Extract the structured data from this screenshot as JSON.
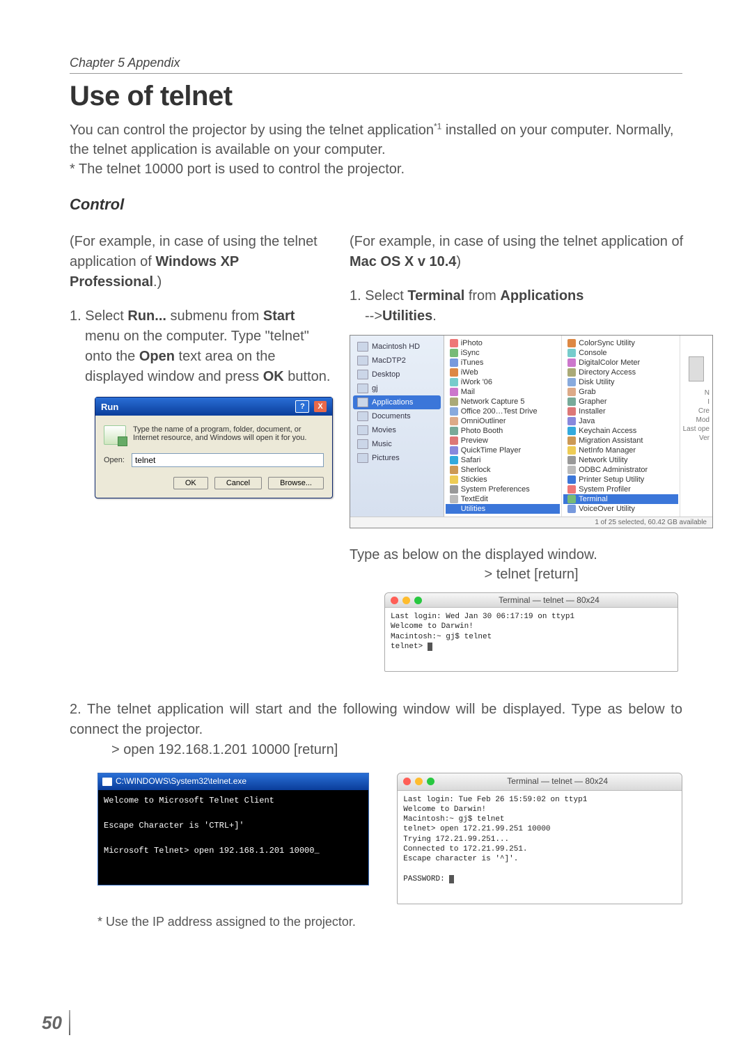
{
  "header": {
    "chapter": "Chapter 5 Appendix"
  },
  "title": "Use of telnet",
  "intro1": "You can control the projector by using the telnet application",
  "intro1_sup": "*1",
  "intro1_tail": " installed on your computer. Normally, the telnet application is available on your computer.",
  "intro2": "* The telnet 10000 port is used to control the projector.",
  "control_hdr": "Control",
  "left": {
    "para": "(For example, in case of using the telnet application of ",
    "para_bold": "Windows XP Professional",
    "para_tail": ".)",
    "step1_a": "1. Select ",
    "step1_b": "Run...",
    "step1_c": " submenu from ",
    "step1_d": "Start",
    "step1_e": " menu on the computer. Type \"telnet\" onto the ",
    "step1_f": "Open",
    "step1_g": " text area on the displayed window and press ",
    "step1_h": "OK",
    "step1_i": " button."
  },
  "run": {
    "title": "Run",
    "desc": "Type the name of a program, folder, document, or Internet resource, and Windows will open it for you.",
    "open_label": "Open:",
    "value": "telnet",
    "ok": "OK",
    "cancel": "Cancel",
    "browse": "Browse..."
  },
  "right": {
    "para": "(For example, in case of using the telnet application of ",
    "para_bold": "Mac OS X v 10.4",
    "para_tail": ")",
    "step1_a": "1. Select ",
    "step1_b": "Terminal",
    "step1_c": " from ",
    "step1_d": "Applications",
    "step1_e": " -->",
    "step1_f": "Utilities",
    "step1_g": "."
  },
  "finder": {
    "sidebar": [
      "Macintosh HD",
      "MacDTP2",
      "Desktop",
      "gj",
      "Applications",
      "Documents",
      "Movies",
      "Music",
      "Pictures"
    ],
    "sidebar_selected": "Applications",
    "apps": [
      "iPhoto",
      "iSync",
      "iTunes",
      "iWeb",
      "iWork '06",
      "Mail",
      "Network Capture 5",
      "Office 200…Test Drive",
      "OmniOutliner",
      "Photo Booth",
      "Preview",
      "QuickTime Player",
      "Safari",
      "Sherlock",
      "Stickies",
      "System Preferences",
      "TextEdit",
      "Utilities"
    ],
    "apps_selected": "Utilities",
    "utils": [
      "ColorSync Utility",
      "Console",
      "DigitalColor Meter",
      "Directory Access",
      "Disk Utility",
      "Grab",
      "Grapher",
      "Installer",
      "Java",
      "Keychain Access",
      "Migration Assistant",
      "NetInfo Manager",
      "Network Utility",
      "ODBC Administrator",
      "Printer Setup Utility",
      "System Profiler",
      "Terminal",
      "VoiceOver Utility"
    ],
    "utils_selected": "Terminal",
    "preview_lines": [
      "N",
      "I",
      "Cre",
      "Mod",
      "Last ope",
      "Ver"
    ],
    "status": "1 of 25 selected, 60.42 GB available"
  },
  "typeline1": "Type  as below on the displayed window.",
  "typeline1_cmd": "> telnet [return]",
  "macterm1": {
    "title": "Terminal — telnet — 80x24",
    "body": "Last login: Wed Jan 30 06:17:19 on ttyp1\nWelcome to Darwin!\nMacintosh:~ gj$ telnet\ntelnet> "
  },
  "step2": "2. The telnet application will start and the following window will be displayed. Type as below to connect the projector.",
  "step2_cmd": "> open 192.168.1.201 10000 [return]",
  "winterm": {
    "title": "C:\\WINDOWS\\System32\\telnet.exe",
    "body": "Welcome to Microsoft Telnet Client\n\nEscape Character is 'CTRL+]'\n\nMicrosoft Telnet> open 192.168.1.201 10000_"
  },
  "macterm2": {
    "title": "Terminal — telnet — 80x24",
    "body": "Last login: Tue Feb 26 15:59:02 on ttyp1\nWelcome to Darwin!\nMacintosh:~ gj$ telnet\ntelnet> open 172.21.99.251 10000\nTrying 172.21.99.251...\nConnected to 172.21.99.251.\nEscape character is '^]'.\n\nPASSWORD: "
  },
  "footnote": "* Use the IP address assigned to the projector.",
  "page_number": "50"
}
